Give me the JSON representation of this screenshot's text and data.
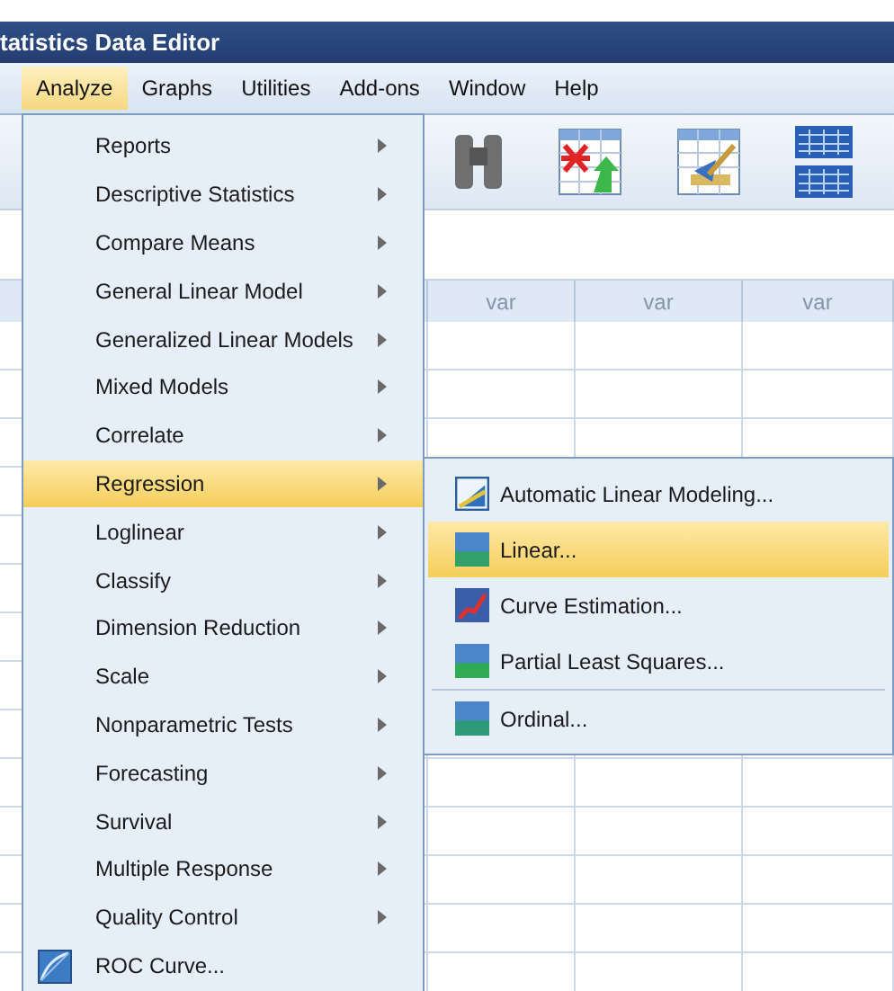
{
  "window": {
    "title": "tatistics Data Editor"
  },
  "menu_bar": [
    {
      "label": "Analyze",
      "selected": true
    },
    {
      "label": "Graphs",
      "selected": false
    },
    {
      "label": "Utilities",
      "selected": false
    },
    {
      "label": "Add-ons",
      "selected": false
    },
    {
      "label": "Window",
      "selected": false
    },
    {
      "label": "Help",
      "selected": false
    }
  ],
  "grid": {
    "columns": [
      "var",
      "var",
      "var"
    ]
  },
  "analyze_menu": [
    {
      "label": "Reports",
      "kind": "submenu",
      "selected": false
    },
    {
      "label": "Descriptive Statistics",
      "kind": "submenu",
      "selected": false
    },
    {
      "label": "Compare Means",
      "kind": "submenu",
      "selected": false
    },
    {
      "label": "General Linear Model",
      "kind": "submenu",
      "selected": false
    },
    {
      "label": "Generalized Linear Models",
      "kind": "submenu",
      "selected": false
    },
    {
      "label": "Mixed Models",
      "kind": "submenu",
      "selected": false
    },
    {
      "label": "Correlate",
      "kind": "submenu",
      "selected": false
    },
    {
      "label": "Regression",
      "kind": "submenu",
      "selected": true
    },
    {
      "label": "Loglinear",
      "kind": "submenu",
      "selected": false
    },
    {
      "label": "Classify",
      "kind": "submenu",
      "selected": false
    },
    {
      "label": "Dimension Reduction",
      "kind": "submenu",
      "selected": false
    },
    {
      "label": "Scale",
      "kind": "submenu",
      "selected": false
    },
    {
      "label": "Nonparametric Tests",
      "kind": "submenu",
      "selected": false
    },
    {
      "label": "Forecasting",
      "kind": "submenu",
      "selected": false
    },
    {
      "label": "Survival",
      "kind": "submenu",
      "selected": false
    },
    {
      "label": "Multiple Response",
      "kind": "submenu",
      "selected": false
    },
    {
      "label": "Quality Control",
      "kind": "submenu",
      "selected": false
    },
    {
      "label": "ROC Curve...",
      "kind": "command",
      "selected": false
    }
  ],
  "regression_menu": [
    {
      "label": "Automatic Linear Modeling...",
      "selected": false,
      "separator_before": false
    },
    {
      "label": "Linear...",
      "selected": true,
      "separator_before": false
    },
    {
      "label": "Curve Estimation...",
      "selected": false,
      "separator_before": false
    },
    {
      "label": "Partial Least Squares...",
      "selected": false,
      "separator_before": false
    },
    {
      "label": "Ordinal...",
      "selected": false,
      "separator_before": true
    }
  ]
}
